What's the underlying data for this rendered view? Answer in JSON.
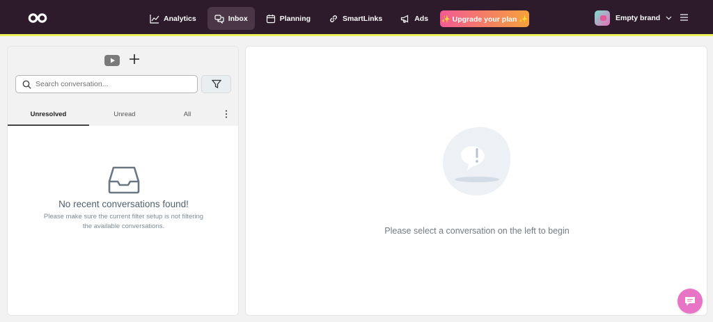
{
  "nav": {
    "items": [
      {
        "label": "Analytics",
        "icon": "chart-line-icon",
        "active": false
      },
      {
        "label": "Inbox",
        "icon": "chat-bubbles-icon",
        "active": true
      },
      {
        "label": "Planning",
        "icon": "calendar-icon",
        "active": false
      },
      {
        "label": "SmartLinks",
        "icon": "link-icon",
        "active": false
      },
      {
        "label": "Ads",
        "icon": "megaphone-icon",
        "active": false
      }
    ],
    "upgrade_label": "✨ Upgrade your plan ✨",
    "brand_name": "Empty brand"
  },
  "sidebar": {
    "search_placeholder": "Search conversation...",
    "tabs": [
      {
        "label": "Unresolved",
        "active": true
      },
      {
        "label": "Unread",
        "active": false
      },
      {
        "label": "All",
        "active": false
      }
    ],
    "empty_title": "No recent conversations found!",
    "empty_description": "Please make sure the current filter setup is not filtering the available conversations."
  },
  "main": {
    "placeholder_message": "Please select a conversation on the left to begin"
  },
  "colors": {
    "topbar": "#2d1a2a",
    "accent_line": "#eaf05a",
    "upgrade_gradient_start": "#f25a93",
    "upgrade_gradient_end": "#f6a13b",
    "chat_bubble": "#e874c6"
  }
}
